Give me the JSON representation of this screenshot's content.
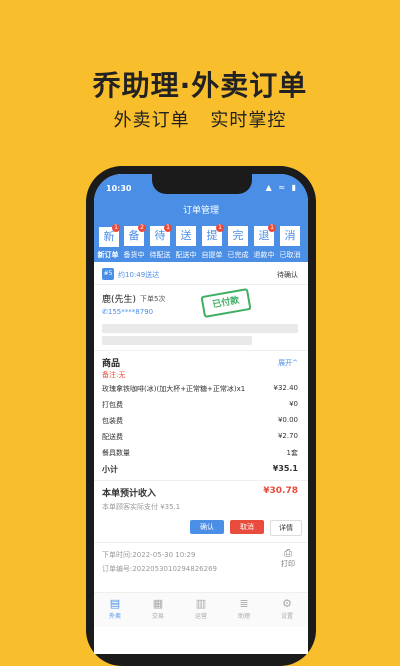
{
  "promo": {
    "headline": "乔助理·外卖订单",
    "sub1": "外卖订单",
    "sub2": "实时掌控"
  },
  "status": {
    "time": "10:30",
    "icons": "▲ ≈ ▮"
  },
  "title": "订单管理",
  "tabs": [
    {
      "label": "新",
      "sub": "新订单",
      "badge": "1",
      "active": true
    },
    {
      "label": "备",
      "sub": "备货中",
      "badge": "2",
      "active": false
    },
    {
      "label": "待",
      "sub": "待配送",
      "badge": "1",
      "active": false
    },
    {
      "label": "送",
      "sub": "配送中",
      "badge": "",
      "active": false
    },
    {
      "label": "提",
      "sub": "自提单",
      "badge": "1",
      "active": false
    },
    {
      "label": "完",
      "sub": "已完成",
      "badge": "",
      "active": false
    },
    {
      "label": "退",
      "sub": "退款中",
      "badge": "1",
      "active": false
    },
    {
      "label": "消",
      "sub": "已取消",
      "badge": "",
      "active": false
    }
  ],
  "order": {
    "num": "#5",
    "eta": "约10:49送达",
    "state": "待确认",
    "customer": "鹿(先生)",
    "count": "下单5次",
    "phone": "155****8790",
    "stamp": "已付款",
    "goods_label": "商品",
    "expand": "展开^",
    "note": "备注:无",
    "items": [
      {
        "name": "玫瑰拿铁咖啡(冰)(加大杯+正常糖+正常冰)x1",
        "value": "¥32.40"
      },
      {
        "name": "打包费",
        "value": "¥0"
      },
      {
        "name": "包装费",
        "value": "¥0.00"
      },
      {
        "name": "配送费",
        "value": "¥2.70"
      },
      {
        "name": "餐具数量",
        "value": "1套"
      }
    ],
    "subtotal_label": "小计",
    "subtotal": "¥35.1",
    "income_label": "本单预计收入",
    "income": "¥30.78",
    "paid": "本单顾客实际支付 ¥35.1",
    "btn_confirm": "确认",
    "btn_cancel": "取消",
    "btn_detail": "详情",
    "time": "下单时间:2022-05-30 10:29",
    "order_no": "订单编号:2022053010294826269",
    "print": "打印"
  },
  "nav": [
    {
      "icon": "▤",
      "label": "外卖",
      "active": true
    },
    {
      "icon": "▦",
      "label": "交易",
      "active": false
    },
    {
      "icon": "▥",
      "label": "运营",
      "active": false
    },
    {
      "icon": "≣",
      "label": "助理",
      "active": false
    },
    {
      "icon": "⚙",
      "label": "设置",
      "active": false
    }
  ],
  "colors": {
    "accent": "#4A8EE6",
    "bg": "#F9BE2C",
    "red": "#E94B3C",
    "green": "#3FAE62"
  }
}
